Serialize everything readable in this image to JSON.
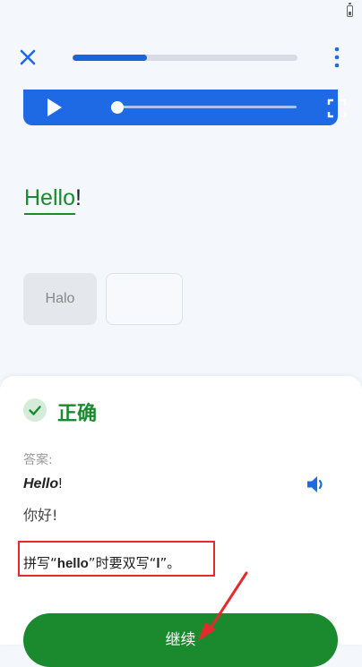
{
  "top_bar": {
    "progress_percent": 33
  },
  "icons": {
    "close": "close-icon",
    "more": "more-vertical-icon",
    "play": "play-icon",
    "fullscreen": "fullscreen-icon",
    "check": "check-icon",
    "speaker": "speaker-icon",
    "arrow": "arrow-annotation-icon"
  },
  "player": {
    "seek_percent": 0
  },
  "exercise": {
    "word": "Hello",
    "punctuation": "!",
    "choices": [
      "Halo",
      ""
    ]
  },
  "result": {
    "title": "正确",
    "answer_label": "答案:",
    "answer_word": "Hello",
    "answer_punctuation": "!",
    "translation": "你好!",
    "note_prefix": "拼写“",
    "note_word": "hello",
    "note_middle": "”时要双写“",
    "note_letter": "l",
    "note_suffix": "”。",
    "continue_label": "继续"
  },
  "colors": {
    "accent_blue": "#1e6ae4",
    "correct_green": "#1b8a2e",
    "annotation_red": "#e32b2b"
  }
}
